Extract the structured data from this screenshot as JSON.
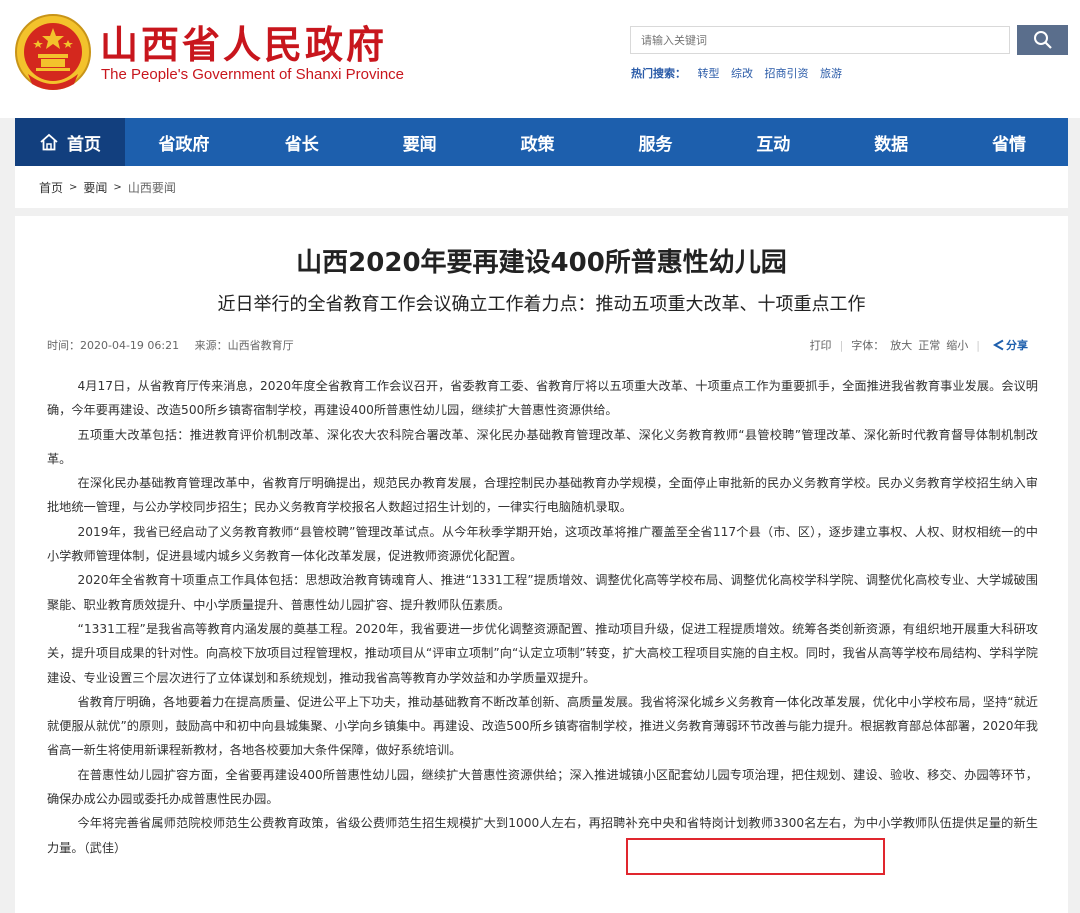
{
  "header": {
    "title": "山西省人民政府",
    "subtitle": "The People's Government of Shanxi Province",
    "search_placeholder": "请输入关键词",
    "hot_label": "热门搜索：",
    "hot_items": [
      "转型",
      "综改",
      "招商引资",
      "旅游"
    ]
  },
  "nav": [
    "首页",
    "省政府",
    "省长",
    "要闻",
    "政策",
    "服务",
    "互动",
    "数据",
    "省情"
  ],
  "breadcrumb": {
    "items": [
      "首页",
      "要闻"
    ],
    "current": "山西要闻",
    "sep": ">"
  },
  "article": {
    "title": "山西2020年要再建设400所普惠性幼儿园",
    "subtitle": "近日举行的全省教育工作会议确立工作着力点：推动五项重大改革、十项重点工作",
    "time": "时间：2020-04-19 06:21",
    "source": "来源：山西省教育厅",
    "print": "打印",
    "font_label": "字体：",
    "font_large": "放大",
    "font_normal": "正常",
    "font_small": "缩小",
    "share": "分享",
    "paragraphs": [
      "4月17日，从省教育厅传来消息，2020年度全省教育工作会议召开，省委教育工委、省教育厅将以五项重大改革、十项重点工作为重要抓手，全面推进我省教育事业发展。会议明确，今年要再建设、改造500所乡镇寄宿制学校，再建设400所普惠性幼儿园，继续扩大普惠性资源供给。",
      "五项重大改革包括：推进教育评价机制改革、深化农大农科院合署改革、深化民办基础教育管理改革、深化义务教育教师“县管校聘”管理改革、深化新时代教育督导体制机制改革。",
      "在深化民办基础教育管理改革中，省教育厅明确提出，规范民办教育发展，合理控制民办基础教育办学规模，全面停止审批新的民办义务教育学校。民办义务教育学校招生纳入审批地统一管理，与公办学校同步招生；民办义务教育学校报名人数超过招生计划的，一律实行电脑随机录取。",
      "2019年，我省已经启动了义务教育教师“县管校聘”管理改革试点。从今年秋季学期开始，这项改革将推广覆盖至全省117个县（市、区），逐步建立事权、人权、财权相统一的中小学教师管理体制，促进县域内城乡义务教育一体化改革发展，促进教师资源优化配置。",
      "2020年全省教育十项重点工作具体包括：思想政治教育铸魂育人、推进“1331工程”提质增效、调整优化高等学校布局、调整优化高校学科学院、调整优化高校专业、大学城破围聚能、职业教育质效提升、中小学质量提升、普惠性幼儿园扩容、提升教师队伍素质。",
      "“1331工程”是我省高等教育内涵发展的奠基工程。2020年，我省要进一步优化调整资源配置、推动项目升级，促进工程提质增效。统筹各类创新资源，有组织地开展重大科研攻关，提升项目成果的针对性。向高校下放项目过程管理权，推动项目从“评审立项制”向“认定立项制”转变，扩大高校工程项目实施的自主权。同时，我省从高等学校布局结构、学科学院建设、专业设置三个层次进行了立体谋划和系统规划，推动我省高等教育办学效益和办学质量双提升。",
      "省教育厅明确，各地要着力在提高质量、促进公平上下功夫，推动基础教育不断改革创新、高质量发展。我省将深化城乡义务教育一体化改革发展，优化中小学校布局，坚持“就近就便服从就优”的原则，鼓励高中和初中向县城集聚、小学向乡镇集中。再建设、改造500所乡镇寄宿制学校，推进义务教育薄弱环节改善与能力提升。根据教育部总体部署，2020年我省高一新生将使用新课程新教材，各地各校要加大条件保障，做好系统培训。",
      "在普惠性幼儿园扩容方面，全省要再建设400所普惠性幼儿园，继续扩大普惠性资源供给；深入推进城镇小区配套幼儿园专项治理，把住规划、建设、验收、移交、办园等环节，确保办成公办园或委托办成普惠性民办园。",
      "今年将完善省属师范院校师范生公费教育政策，省级公费师范生招生规模扩大到1000人左右，再招聘补充中央和省特岗计划教师3300名左右，为中小学教师队伍提供足量的新生力量。（武佳）"
    ]
  },
  "colors": {
    "brand_red": "#c8161d",
    "nav_blue": "#1d5fad",
    "nav_active": "#123f7e",
    "highlight_red": "#e0262e"
  },
  "icons": [
    "emblem-icon",
    "search-icon",
    "home-icon",
    "share-icon"
  ]
}
